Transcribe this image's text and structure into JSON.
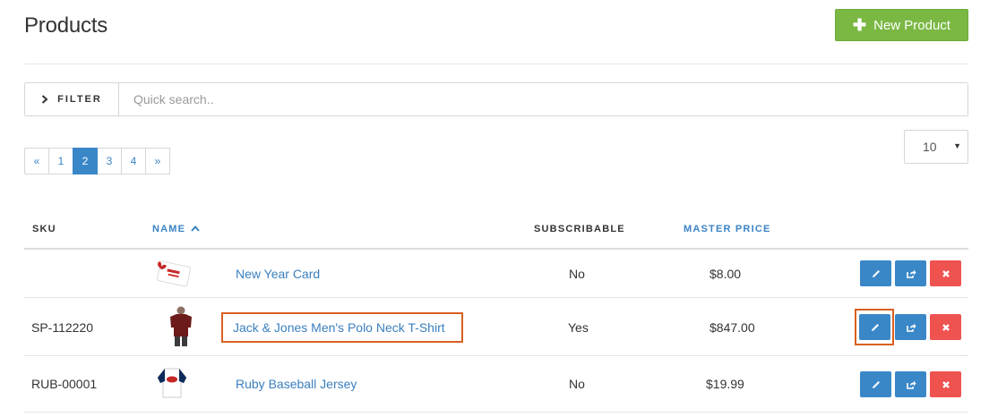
{
  "header": {
    "title": "Products",
    "new_button_label": "New Product"
  },
  "filter": {
    "label": "FILTER",
    "search_placeholder": "Quick search.."
  },
  "pagination": {
    "prev": "«",
    "pages": [
      "1",
      "2",
      "3",
      "4"
    ],
    "next": "»",
    "active_page": "2"
  },
  "per_page": {
    "selected": "10"
  },
  "table": {
    "columns": {
      "sku": "SKU",
      "name": "NAME",
      "subscribable": "SUBSCRIBABLE",
      "master_price": "MASTER PRICE"
    },
    "rows": [
      {
        "sku": "",
        "name": "New Year Card",
        "subscribable": "No",
        "price": "$8.00",
        "image": "gift-card-thumbnail"
      },
      {
        "sku": "SP-112220",
        "name": "Jack & Jones Men's Polo Neck T-Shirt",
        "subscribable": "Yes",
        "price": "$847.00",
        "image": "polo-shirt-thumbnail"
      },
      {
        "sku": "RUB-00001",
        "name": "Ruby Baseball Jersey",
        "subscribable": "No",
        "price": "$19.99",
        "image": "baseball-jersey-thumbnail"
      }
    ]
  },
  "colors": {
    "new_button": "#7ab843",
    "primary": "#3a87c8",
    "danger": "#ef5350",
    "highlight": "#d9601f",
    "link": "#3a7fbf"
  },
  "icons": [
    "plus-icon",
    "chevron-right-icon",
    "caret-down-icon",
    "sort-ascending-icon",
    "pencil-icon",
    "share-icon",
    "close-icon"
  ]
}
